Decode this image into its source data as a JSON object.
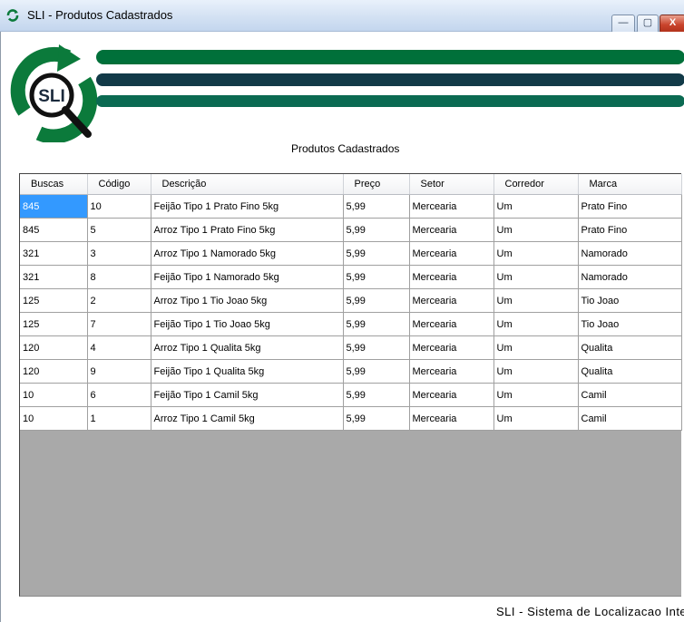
{
  "window": {
    "title": "SLI - Produtos Cadastrados",
    "buttons": {
      "minimize": "—",
      "maximize": "▢",
      "close": "X"
    }
  },
  "logo": {
    "text": "SLI"
  },
  "caption": "Produtos Cadastrados",
  "table": {
    "columns": [
      "Buscas",
      "Código",
      "Descrição",
      "Preço",
      "Setor",
      "Corredor",
      "Marca"
    ],
    "rows": [
      [
        "845",
        "10",
        "Feijão Tipo 1 Prato Fino 5kg",
        "5,99",
        "Mercearia",
        "Um",
        "Prato Fino"
      ],
      [
        "845",
        "5",
        "Arroz Tipo 1 Prato Fino 5kg",
        "5,99",
        "Mercearia",
        "Um",
        "Prato Fino"
      ],
      [
        "321",
        "3",
        "Arroz Tipo 1 Namorado 5kg",
        "5,99",
        "Mercearia",
        "Um",
        "Namorado"
      ],
      [
        "321",
        "8",
        "Feijão Tipo 1 Namorado 5kg",
        "5,99",
        "Mercearia",
        "Um",
        "Namorado"
      ],
      [
        "125",
        "2",
        "Arroz Tipo 1 Tio Joao 5kg",
        "5,99",
        "Mercearia",
        "Um",
        "Tio Joao"
      ],
      [
        "125",
        "7",
        "Feijão Tipo 1 Tio Joao 5kg",
        "5,99",
        "Mercearia",
        "Um",
        "Tio Joao"
      ],
      [
        "120",
        "4",
        "Arroz Tipo 1 Qualita 5kg",
        "5,99",
        "Mercearia",
        "Um",
        "Qualita"
      ],
      [
        "120",
        "9",
        "Feijão Tipo 1 Qualita 5kg",
        "5,99",
        "Mercearia",
        "Um",
        "Qualita"
      ],
      [
        "10",
        "6",
        "Feijão Tipo 1 Camil 5kg",
        "5,99",
        "Mercearia",
        "Um",
        "Camil"
      ],
      [
        "10",
        "1",
        "Arroz Tipo 1 Camil 5kg",
        "5,99",
        "Mercearia",
        "Um",
        "Camil"
      ]
    ],
    "selected_cell": {
      "row": 0,
      "col": 0
    }
  },
  "footer": "SLI - Sistema de Localizacao Interna",
  "colors": {
    "accent_green": "#00703a",
    "accent_dark": "#123a48",
    "selection": "#3399ff",
    "grid_empty": "#a9a9a9"
  }
}
